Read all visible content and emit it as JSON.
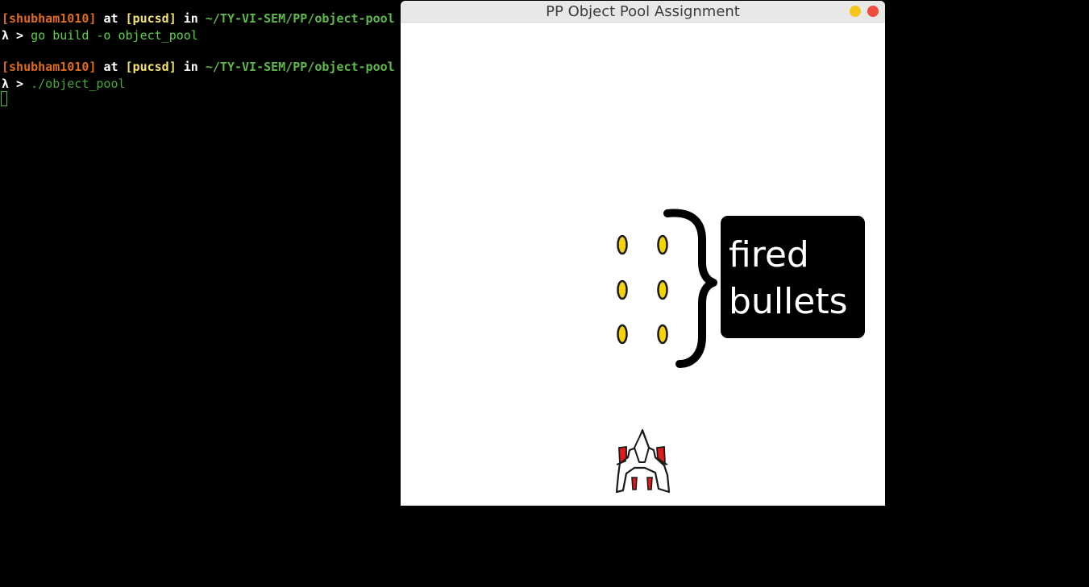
{
  "terminal": {
    "prompt1": {
      "user": "[shubham1010]",
      "at": "at",
      "host": "[pucsd]",
      "in": "in",
      "path": "~/TY-VI-SEM/PP/object-pool"
    },
    "cmd1": {
      "lambda": "λ >",
      "command": "go build -o object_pool"
    },
    "prompt2": {
      "user": "[shubham1010]",
      "at": "at",
      "host": "[pucsd]",
      "in": "in",
      "path": "~/TY-VI-SEM/PP/object-pool"
    },
    "cmd2": {
      "lambda": "λ >",
      "command": "./object_pool"
    }
  },
  "window": {
    "title": "PP Object Pool Assignment",
    "buttons": [
      "minimize",
      "close"
    ]
  },
  "game": {
    "bullets_fired": 6,
    "annotation": {
      "line1": "fired",
      "line2": "bullets"
    }
  },
  "colors": {
    "username": "#e06c1b",
    "hostname": "#f3e36b",
    "path": "#5fb84a",
    "command": "#5fd04a",
    "bullet_fill": "#f5d20c",
    "ship_accent": "#e0191a",
    "minimize_button": "#f5c518",
    "close_button": "#ef4b3c"
  }
}
